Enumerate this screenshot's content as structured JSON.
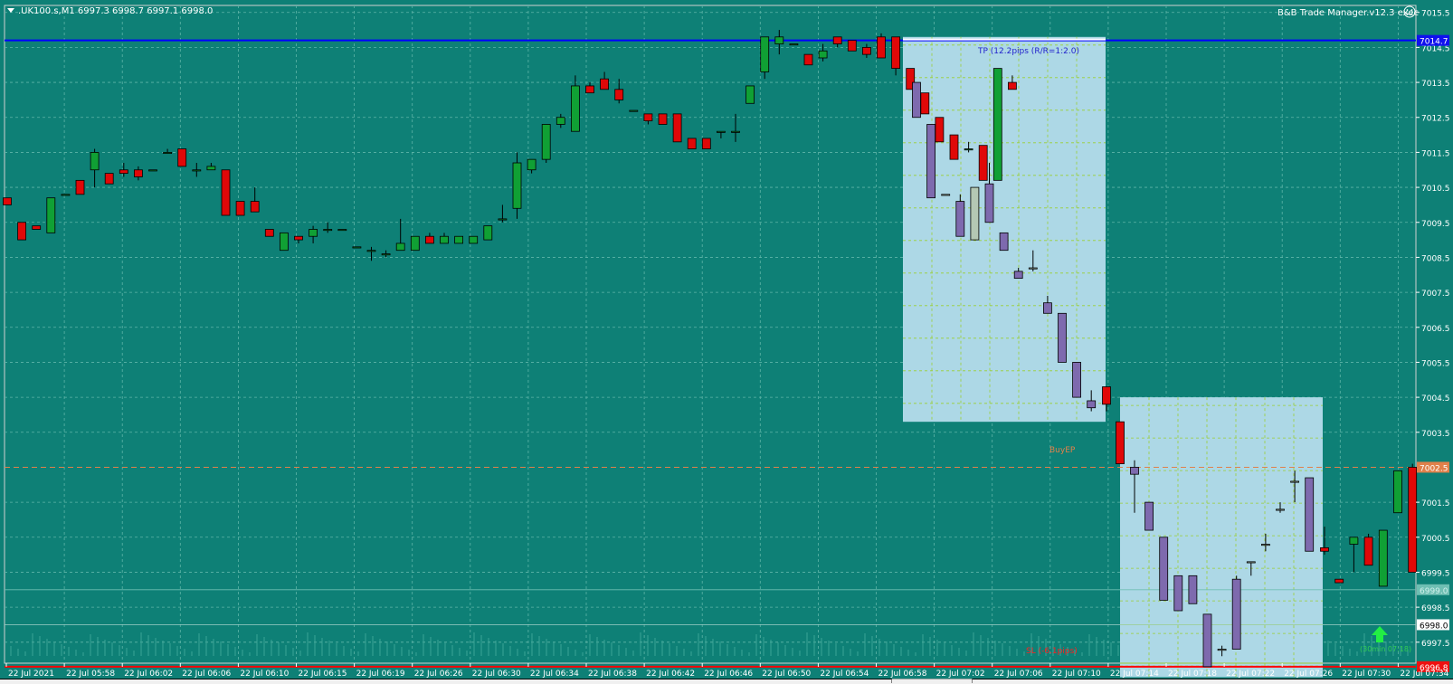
{
  "header": {
    "symbol_info": ".UK100.s,M1  6997.3 6998.7 6997.1 6998.0",
    "dropdown_icon": "triangle-down-icon",
    "ea_name": "B&B Trade Manager.v12.3 exec",
    "ea_icon": "smiley-icon"
  },
  "colors": {
    "background": "#0E8076",
    "grid": "#5FB5A8",
    "bull": "#10A034",
    "bear": "#E00808",
    "projection_bg": "#ADD8E6",
    "projection_candle_bear": "#7E6AAE",
    "projection_candle_bull": "#B4C8B4",
    "tp_line": "#0000FF",
    "sl_line": "#FF0000",
    "entry_line": "#E0804A",
    "projection_grid": "#9ACD32"
  },
  "chart_data": {
    "type": "candlestick",
    "symbol": ".UK100.s",
    "timeframe": "M1",
    "ylim": [
      6996.9,
      7015.7
    ],
    "y_ticks": [
      "7015.5",
      "7014.5",
      "7013.5",
      "7012.5",
      "7011.5",
      "7010.5",
      "7009.5",
      "7008.5",
      "7007.5",
      "7006.5",
      "7005.5",
      "7004.5",
      "7003.5",
      "7001.5",
      "7000.5",
      "6999.5",
      "6998.5",
      "6997.5"
    ],
    "x_ticks": [
      "22 Jul 2021",
      "22 Jul 05:58",
      "22 Jul 06:02",
      "22 Jul 06:06",
      "22 Jul 06:10",
      "22 Jul 06:15",
      "22 Jul 06:19",
      "22 Jul 06:26",
      "22 Jul 06:30",
      "22 Jul 06:34",
      "22 Jul 06:38",
      "22 Jul 06:42",
      "22 Jul 06:46",
      "22 Jul 06:50",
      "22 Jul 06:54",
      "22 Jul 06:58",
      "22 Jul 07:02",
      "22 Jul 07:06",
      "22 Jul 07:10",
      "22 Jul 07:14",
      "22 Jul 07:18",
      "22 Jul 07:22",
      "22 Jul 07:26",
      "22 Jul 07:30",
      "22 Jul 07:34"
    ],
    "candles": [
      [
        10.2,
        10.2,
        10.0,
        10.0
      ],
      [
        9.5,
        9.5,
        9.0,
        9.0
      ],
      [
        9.4,
        9.4,
        9.3,
        9.3
      ],
      [
        9.2,
        10.2,
        9.2,
        10.2
      ],
      [
        10.3,
        10.3,
        10.3,
        10.3
      ],
      [
        10.7,
        10.7,
        10.3,
        10.3
      ],
      [
        11.0,
        11.6,
        10.5,
        11.5
      ],
      [
        10.9,
        10.9,
        10.6,
        10.6
      ],
      [
        11.0,
        11.2,
        10.8,
        10.9
      ],
      [
        11.0,
        11.1,
        10.7,
        10.8
      ],
      [
        11.0,
        11.0,
        11.0,
        11.0
      ],
      [
        11.5,
        11.6,
        11.5,
        11.5
      ],
      [
        11.6,
        11.6,
        11.1,
        11.1
      ],
      [
        11.0,
        11.2,
        10.8,
        11.0
      ],
      [
        11.0,
        11.2,
        11.0,
        11.1
      ],
      [
        11.0,
        11.0,
        9.7,
        9.7
      ],
      [
        10.1,
        10.1,
        9.7,
        9.7
      ],
      [
        10.1,
        10.5,
        9.8,
        9.8
      ],
      [
        9.3,
        9.3,
        9.1,
        9.1
      ],
      [
        8.7,
        9.2,
        8.7,
        9.2
      ],
      [
        9.1,
        9.1,
        8.9,
        9.0
      ],
      [
        9.1,
        9.4,
        8.9,
        9.3
      ],
      [
        9.3,
        9.5,
        9.2,
        9.3
      ],
      [
        9.3,
        9.3,
        9.3,
        9.3
      ],
      [
        8.8,
        8.8,
        8.8,
        8.8
      ],
      [
        8.7,
        8.8,
        8.4,
        8.7
      ],
      [
        8.6,
        8.7,
        8.5,
        8.6
      ],
      [
        8.7,
        9.6,
        8.7,
        8.9
      ],
      [
        8.7,
        9.1,
        8.7,
        9.1
      ],
      [
        9.1,
        9.2,
        8.9,
        8.9
      ],
      [
        8.9,
        9.2,
        8.9,
        9.1
      ],
      [
        8.9,
        9.1,
        8.9,
        9.1
      ],
      [
        8.9,
        9.1,
        8.9,
        9.1
      ],
      [
        9.0,
        9.4,
        9.0,
        9.4
      ],
      [
        9.6,
        10.0,
        9.5,
        9.6
      ],
      [
        9.9,
        11.5,
        9.6,
        11.2
      ],
      [
        11.0,
        11.3,
        10.9,
        11.3
      ],
      [
        11.3,
        11.5,
        11.2,
        12.3
      ],
      [
        12.3,
        12.6,
        12.2,
        12.5
      ],
      [
        12.1,
        13.7,
        12.1,
        13.4
      ],
      [
        13.4,
        13.5,
        13.3,
        13.2
      ],
      [
        13.6,
        13.8,
        13.3,
        13.3
      ],
      [
        13.3,
        13.6,
        12.9,
        13.0
      ],
      [
        12.7,
        12.7,
        12.7,
        12.7
      ],
      [
        12.6,
        12.6,
        12.3,
        12.4
      ],
      [
        12.6,
        12.6,
        12.3,
        12.3
      ],
      [
        12.6,
        12.6,
        11.8,
        11.8
      ],
      [
        11.9,
        11.9,
        11.6,
        11.6
      ],
      [
        11.9,
        11.9,
        11.6,
        11.6
      ],
      [
        12.1,
        12.1,
        11.9,
        12.1
      ],
      [
        12.1,
        12.6,
        11.8,
        12.1
      ],
      [
        12.9,
        13.4,
        12.9,
        13.4
      ],
      [
        13.8,
        14.8,
        13.6,
        14.8
      ],
      [
        14.6,
        15.0,
        14.3,
        14.8
      ],
      [
        14.6,
        14.6,
        14.6,
        14.6
      ],
      [
        14.3,
        14.3,
        14.0,
        14.0
      ],
      [
        14.2,
        14.6,
        14.1,
        14.4
      ],
      [
        14.8,
        14.8,
        14.5,
        14.6
      ],
      [
        14.7,
        14.7,
        14.4,
        14.4
      ],
      [
        14.5,
        14.6,
        14.2,
        14.3
      ],
      [
        14.8,
        14.9,
        14.2,
        14.2
      ],
      [
        14.8,
        14.8,
        13.7,
        13.9
      ],
      [
        13.9,
        13.9,
        13.4,
        13.3
      ],
      [
        13.2,
        13.2,
        12.6,
        12.6
      ],
      [
        12.5,
        12.5,
        11.8,
        11.8
      ],
      [
        12.0,
        12.0,
        11.3,
        11.3
      ],
      [
        11.6,
        11.8,
        11.5,
        11.6
      ],
      [
        11.7,
        11.7,
        10.7,
        10.7
      ],
      [
        10.7,
        13.5,
        10.7,
        13.9
      ],
      [
        13.5,
        13.7,
        13.3,
        13.3
      ]
    ],
    "projection_candles_upper": [
      [
        13.5,
        13.5,
        12.5,
        12.5
      ],
      [
        12.3,
        12.3,
        10.2,
        10.2
      ],
      [
        10.3,
        10.3,
        10.3,
        10.3
      ],
      [
        10.1,
        10.3,
        9.1,
        9.1
      ],
      [
        9.0,
        10.5,
        9.0,
        10.5
      ],
      [
        10.6,
        11.2,
        9.5,
        9.5
      ],
      [
        9.2,
        9.2,
        8.7,
        8.7
      ],
      [
        8.1,
        8.2,
        7.9,
        7.9
      ],
      [
        8.2,
        8.7,
        8.1,
        8.2
      ],
      [
        7.2,
        7.4,
        6.9,
        6.9
      ],
      [
        6.9,
        6.9,
        5.5,
        5.5
      ],
      [
        5.5,
        5.5,
        4.5,
        4.5
      ],
      [
        4.4,
        4.7,
        4.1,
        4.2
      ]
    ],
    "projection_candles_lower": [
      [
        2.5,
        2.7,
        1.2,
        2.3
      ],
      [
        1.5,
        1.5,
        0.7,
        0.7
      ],
      [
        0.5,
        0.5,
        -1.3,
        -1.3
      ],
      [
        -0.6,
        -0.6,
        -1.6,
        -1.6
      ],
      [
        -0.6,
        -0.6,
        -1.4,
        -1.4
      ],
      [
        -1.7,
        -1.7,
        -3.2,
        -3.2
      ],
      [
        -2.7,
        -2.6,
        -2.9,
        -2.7
      ],
      [
        -0.7,
        -0.6,
        -2.7,
        -2.7
      ],
      [
        -0.2,
        -0.6,
        -0.2,
        -0.2
      ],
      [
        0.3,
        0.6,
        0.1,
        0.3
      ],
      [
        1.3,
        1.5,
        1.2,
        1.3
      ],
      [
        2.1,
        2.4,
        1.5,
        2.1
      ],
      [
        2.2,
        2.2,
        1.0,
        0.1
      ]
    ],
    "tail_candles": [
      [
        0.2,
        0.8,
        0.0,
        0.1
      ],
      [
        -0.7,
        -0.7,
        -0.8,
        -0.8
      ],
      [
        0.3,
        0.3,
        -0.5,
        0.5
      ],
      [
        0.5,
        0.6,
        -0.3,
        -0.3
      ],
      [
        -0.9,
        0.7,
        -0.9,
        0.7
      ],
      [
        1.2,
        2.4,
        1.2,
        2.4
      ],
      [
        2.5,
        2.6,
        -0.5,
        -0.5
      ]
    ],
    "series_labels": [
      "TP (12.2pips (R/R=1:2.0)",
      "BuyEP",
      "SL (-6.1pips)"
    ],
    "tp_label": "TP (12.2pips (R/R=1:2.0)",
    "entry_label": "BuyEP",
    "sl_label": "SL (-6.1pips)",
    "price_tags": {
      "tp": "7014.7",
      "entry": "7002.5",
      "sl": "6996.8",
      "line1": "6999.0",
      "current": "6998.0"
    },
    "timer_label": "(30min 07:18)",
    "levels": {
      "tp": 7014.7,
      "entry": 7002.5,
      "sl": 6996.8,
      "current": 6998.0
    }
  }
}
